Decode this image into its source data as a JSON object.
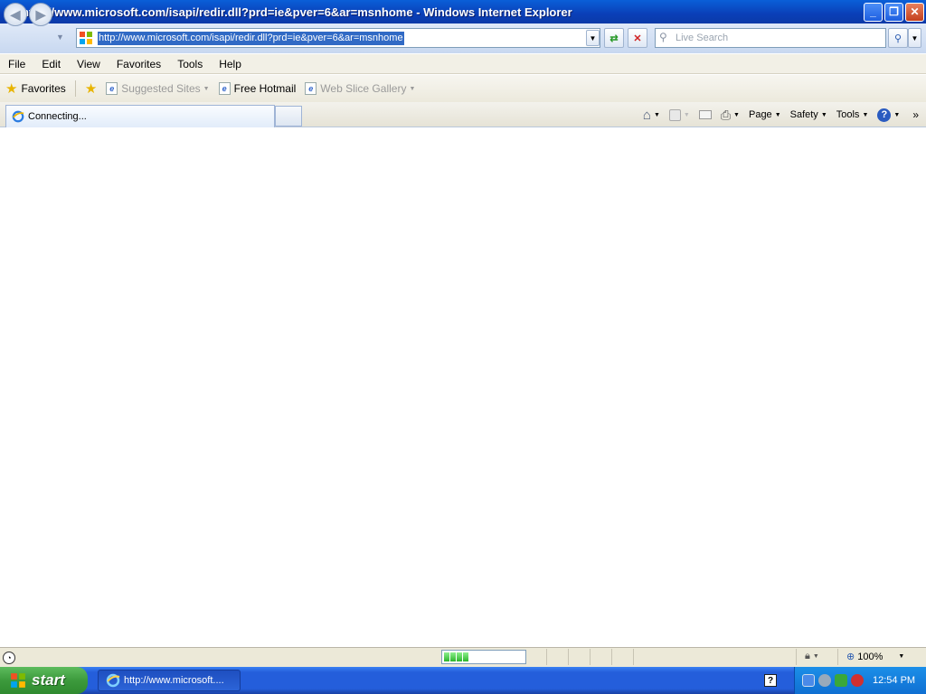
{
  "window": {
    "title": "http://www.microsoft.com/isapi/redir.dll?prd=ie&pver=6&ar=msnhome - Windows Internet Explorer",
    "minimize": "_",
    "maximize": "❐",
    "close": "✕"
  },
  "address": {
    "url": "http://www.microsoft.com/isapi/redir.dll?prd=ie&pver=6&ar=msnhome",
    "search_placeholder": "Live Search"
  },
  "menu": {
    "items": [
      "File",
      "Edit",
      "View",
      "Favorites",
      "Tools",
      "Help"
    ]
  },
  "favorites_bar": {
    "favorites_label": "Favorites",
    "items": [
      "Suggested Sites",
      "Free Hotmail",
      "Web Slice Gallery"
    ]
  },
  "tab": {
    "label": "Connecting..."
  },
  "command_bar": {
    "page": "Page",
    "safety": "Safety",
    "tools": "Tools"
  },
  "status_bar": {
    "zoom": "100%",
    "progress_fraction": 0.3
  },
  "taskbar": {
    "start_label": "start",
    "task_item": "http://www.microsoft....",
    "clock": "12:54 PM"
  },
  "colors": {
    "title_bar": "#0a4fc8",
    "selection": "#316ac5",
    "taskbar": "#245edb",
    "start_button": "#3c9a3c"
  }
}
